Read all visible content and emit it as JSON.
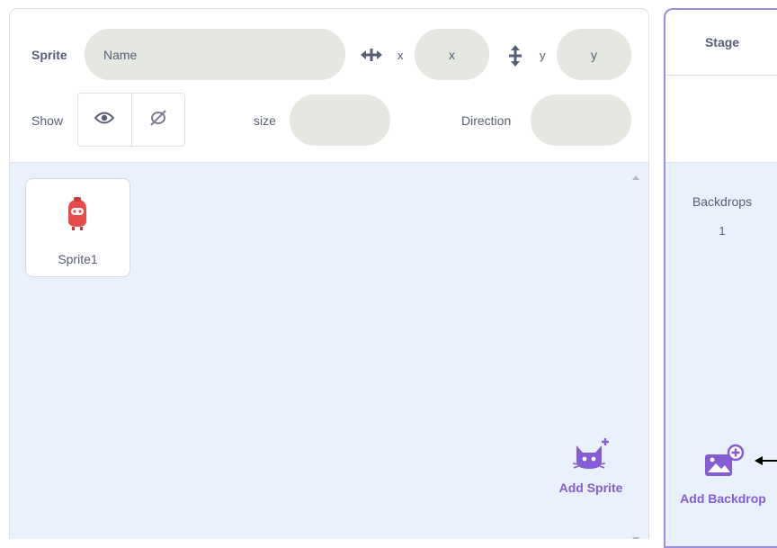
{
  "sprite_info": {
    "sprite_label": "Sprite",
    "name_placeholder": "Name",
    "x_label": "x",
    "x_placeholder": "x",
    "y_label": "y",
    "y_placeholder": "y",
    "show_label": "Show",
    "size_label": "size",
    "size_value": "",
    "direction_label": "Direction",
    "direction_value": ""
  },
  "sprites": [
    {
      "name": "Sprite1",
      "icon": "sprite-robot-icon"
    }
  ],
  "add_sprite": {
    "label": "Add Sprite",
    "icon": "cat-add-icon"
  },
  "stage": {
    "title": "Stage",
    "backdrops_label": "Backdrops",
    "backdrops_count": "1",
    "add_backdrop_label": "Add Backdrop",
    "add_backdrop_icon": "image-add-icon"
  },
  "colors": {
    "accent": "#855cd6",
    "stage_border": "#9c8de3",
    "pill_bg": "#e4e8e0",
    "pane_bg": "#e9f1fc",
    "sprite_red": "#e74c4c"
  }
}
